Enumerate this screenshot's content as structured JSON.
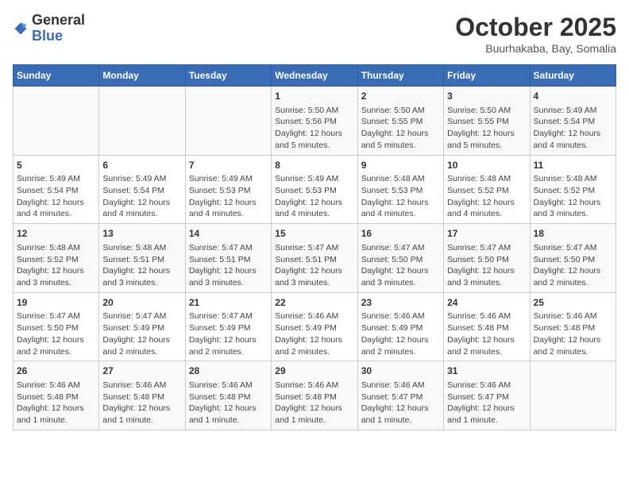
{
  "header": {
    "logo_general": "General",
    "logo_blue": "Blue",
    "month": "October 2025",
    "location": "Buurhakaba, Bay, Somalia"
  },
  "weekdays": [
    "Sunday",
    "Monday",
    "Tuesday",
    "Wednesday",
    "Thursday",
    "Friday",
    "Saturday"
  ],
  "weeks": [
    [
      {
        "day": "",
        "info": ""
      },
      {
        "day": "",
        "info": ""
      },
      {
        "day": "",
        "info": ""
      },
      {
        "day": "1",
        "info": "Sunrise: 5:50 AM\nSunset: 5:56 PM\nDaylight: 12 hours\nand 5 minutes."
      },
      {
        "day": "2",
        "info": "Sunrise: 5:50 AM\nSunset: 5:55 PM\nDaylight: 12 hours\nand 5 minutes."
      },
      {
        "day": "3",
        "info": "Sunrise: 5:50 AM\nSunset: 5:55 PM\nDaylight: 12 hours\nand 5 minutes."
      },
      {
        "day": "4",
        "info": "Sunrise: 5:49 AM\nSunset: 5:54 PM\nDaylight: 12 hours\nand 4 minutes."
      }
    ],
    [
      {
        "day": "5",
        "info": "Sunrise: 5:49 AM\nSunset: 5:54 PM\nDaylight: 12 hours\nand 4 minutes."
      },
      {
        "day": "6",
        "info": "Sunrise: 5:49 AM\nSunset: 5:54 PM\nDaylight: 12 hours\nand 4 minutes."
      },
      {
        "day": "7",
        "info": "Sunrise: 5:49 AM\nSunset: 5:53 PM\nDaylight: 12 hours\nand 4 minutes."
      },
      {
        "day": "8",
        "info": "Sunrise: 5:49 AM\nSunset: 5:53 PM\nDaylight: 12 hours\nand 4 minutes."
      },
      {
        "day": "9",
        "info": "Sunrise: 5:48 AM\nSunset: 5:53 PM\nDaylight: 12 hours\nand 4 minutes."
      },
      {
        "day": "10",
        "info": "Sunrise: 5:48 AM\nSunset: 5:52 PM\nDaylight: 12 hours\nand 4 minutes."
      },
      {
        "day": "11",
        "info": "Sunrise: 5:48 AM\nSunset: 5:52 PM\nDaylight: 12 hours\nand 3 minutes."
      }
    ],
    [
      {
        "day": "12",
        "info": "Sunrise: 5:48 AM\nSunset: 5:52 PM\nDaylight: 12 hours\nand 3 minutes."
      },
      {
        "day": "13",
        "info": "Sunrise: 5:48 AM\nSunset: 5:51 PM\nDaylight: 12 hours\nand 3 minutes."
      },
      {
        "day": "14",
        "info": "Sunrise: 5:47 AM\nSunset: 5:51 PM\nDaylight: 12 hours\nand 3 minutes."
      },
      {
        "day": "15",
        "info": "Sunrise: 5:47 AM\nSunset: 5:51 PM\nDaylight: 12 hours\nand 3 minutes."
      },
      {
        "day": "16",
        "info": "Sunrise: 5:47 AM\nSunset: 5:50 PM\nDaylight: 12 hours\nand 3 minutes."
      },
      {
        "day": "17",
        "info": "Sunrise: 5:47 AM\nSunset: 5:50 PM\nDaylight: 12 hours\nand 3 minutes."
      },
      {
        "day": "18",
        "info": "Sunrise: 5:47 AM\nSunset: 5:50 PM\nDaylight: 12 hours\nand 2 minutes."
      }
    ],
    [
      {
        "day": "19",
        "info": "Sunrise: 5:47 AM\nSunset: 5:50 PM\nDaylight: 12 hours\nand 2 minutes."
      },
      {
        "day": "20",
        "info": "Sunrise: 5:47 AM\nSunset: 5:49 PM\nDaylight: 12 hours\nand 2 minutes."
      },
      {
        "day": "21",
        "info": "Sunrise: 5:47 AM\nSunset: 5:49 PM\nDaylight: 12 hours\nand 2 minutes."
      },
      {
        "day": "22",
        "info": "Sunrise: 5:46 AM\nSunset: 5:49 PM\nDaylight: 12 hours\nand 2 minutes."
      },
      {
        "day": "23",
        "info": "Sunrise: 5:46 AM\nSunset: 5:49 PM\nDaylight: 12 hours\nand 2 minutes."
      },
      {
        "day": "24",
        "info": "Sunrise: 5:46 AM\nSunset: 5:48 PM\nDaylight: 12 hours\nand 2 minutes."
      },
      {
        "day": "25",
        "info": "Sunrise: 5:46 AM\nSunset: 5:48 PM\nDaylight: 12 hours\nand 2 minutes."
      }
    ],
    [
      {
        "day": "26",
        "info": "Sunrise: 5:46 AM\nSunset: 5:48 PM\nDaylight: 12 hours\nand 1 minute."
      },
      {
        "day": "27",
        "info": "Sunrise: 5:46 AM\nSunset: 5:48 PM\nDaylight: 12 hours\nand 1 minute."
      },
      {
        "day": "28",
        "info": "Sunrise: 5:46 AM\nSunset: 5:48 PM\nDaylight: 12 hours\nand 1 minute."
      },
      {
        "day": "29",
        "info": "Sunrise: 5:46 AM\nSunset: 5:48 PM\nDaylight: 12 hours\nand 1 minute."
      },
      {
        "day": "30",
        "info": "Sunrise: 5:46 AM\nSunset: 5:47 PM\nDaylight: 12 hours\nand 1 minute."
      },
      {
        "day": "31",
        "info": "Sunrise: 5:46 AM\nSunset: 5:47 PM\nDaylight: 12 hours\nand 1 minute."
      },
      {
        "day": "",
        "info": ""
      }
    ]
  ]
}
